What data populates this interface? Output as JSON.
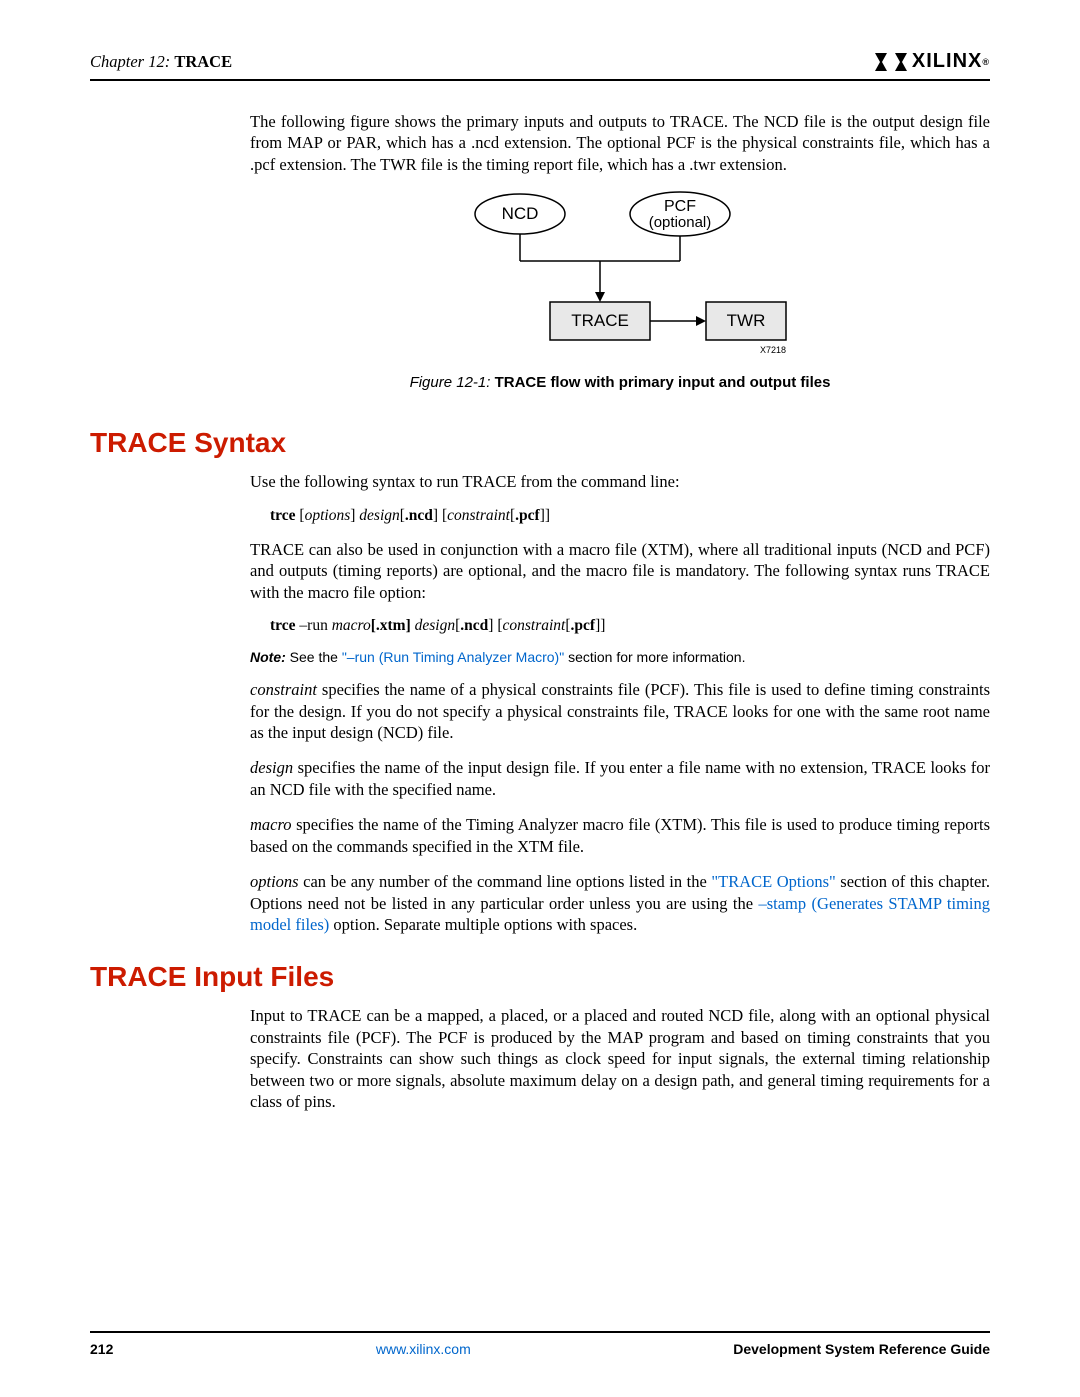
{
  "header": {
    "chapter_prefix": "Chapter 12:",
    "chapter_title": "TRACE",
    "logo_text": "XILINX"
  },
  "intro_para": "The following figure shows the primary inputs and outputs to TRACE. The NCD file is the output design file from MAP or PAR, which has a .ncd extension. The optional PCF is the physical constraints file, which has a .pcf extension. The TWR file is the timing report file, which has a .twr extension.",
  "diagram": {
    "ncd": "NCD",
    "pcf_top": "PCF",
    "pcf_bot": "(optional)",
    "trace": "TRACE",
    "twr": "TWR",
    "id": "X7218"
  },
  "figure_label": "Figure 12-1:",
  "figure_title": "TRACE flow with primary input and output files",
  "syntax": {
    "heading": "TRACE Syntax",
    "p1": "Use the following syntax to run TRACE from the command line:",
    "cmd1": {
      "trce": "trce",
      "options": "options",
      "design": "design",
      "ncd": ".ncd",
      "constraint": "constraint",
      "pcf": ".pcf"
    },
    "p2": "TRACE can also be used in conjunction with a macro file (XTM), where all traditional inputs (NCD and PCF) and outputs (timing reports) are optional, and the macro file is mandatory. The following syntax runs TRACE with the macro file option:",
    "cmd2": {
      "trce": "trce",
      "run": "–run",
      "macro": "macro",
      "xtm": "[.xtm]",
      "design": "design",
      "ncd": ".ncd",
      "constraint": "constraint",
      "pcf": ".pcf"
    },
    "note_label": "Note:",
    "note_text_a": "See the ",
    "note_link": "\"–run (Run Timing Analyzer Macro)\"",
    "note_text_b": " section for more information.",
    "constraint_term": "constraint",
    "constraint_text": " specifies the name of a physical constraints file (PCF). This file is used to define timing constraints for the design. If you do not specify a physical constraints file, TRACE looks for one with the same root name as the input design (NCD) file.",
    "design_term": "design",
    "design_text": " specifies the name of the input design file. If you enter a file name with no extension, TRACE looks for an NCD file with the specified name.",
    "macro_term": "macro",
    "macro_text": " specifies the name of the Timing Analyzer macro file (XTM). This file is used to produce timing reports based on the commands specified in the XTM file.",
    "options_term": "options",
    "options_text_a": " can be any number of the command line options listed in the ",
    "options_link1": "\"TRACE Options\"",
    "options_text_b": " section of this chapter. Options need not be listed in any particular order unless you are using the ",
    "options_link2": "–stamp (Generates STAMP timing model files)",
    "options_text_c": " option. Separate multiple options with spaces."
  },
  "input_files": {
    "heading": "TRACE Input Files",
    "p1": "Input to TRACE can be a mapped, a placed, or a placed and routed NCD file, along with an optional physical constraints file (PCF). The PCF is produced by the MAP program and based on timing constraints that you specify. Constraints can show such things as clock speed for input signals, the external timing relationship between two or more signals, absolute maximum delay on a design path, and general timing requirements for a class of pins."
  },
  "footer": {
    "page": "212",
    "url": "www.xilinx.com",
    "guide": "Development System Reference Guide"
  }
}
